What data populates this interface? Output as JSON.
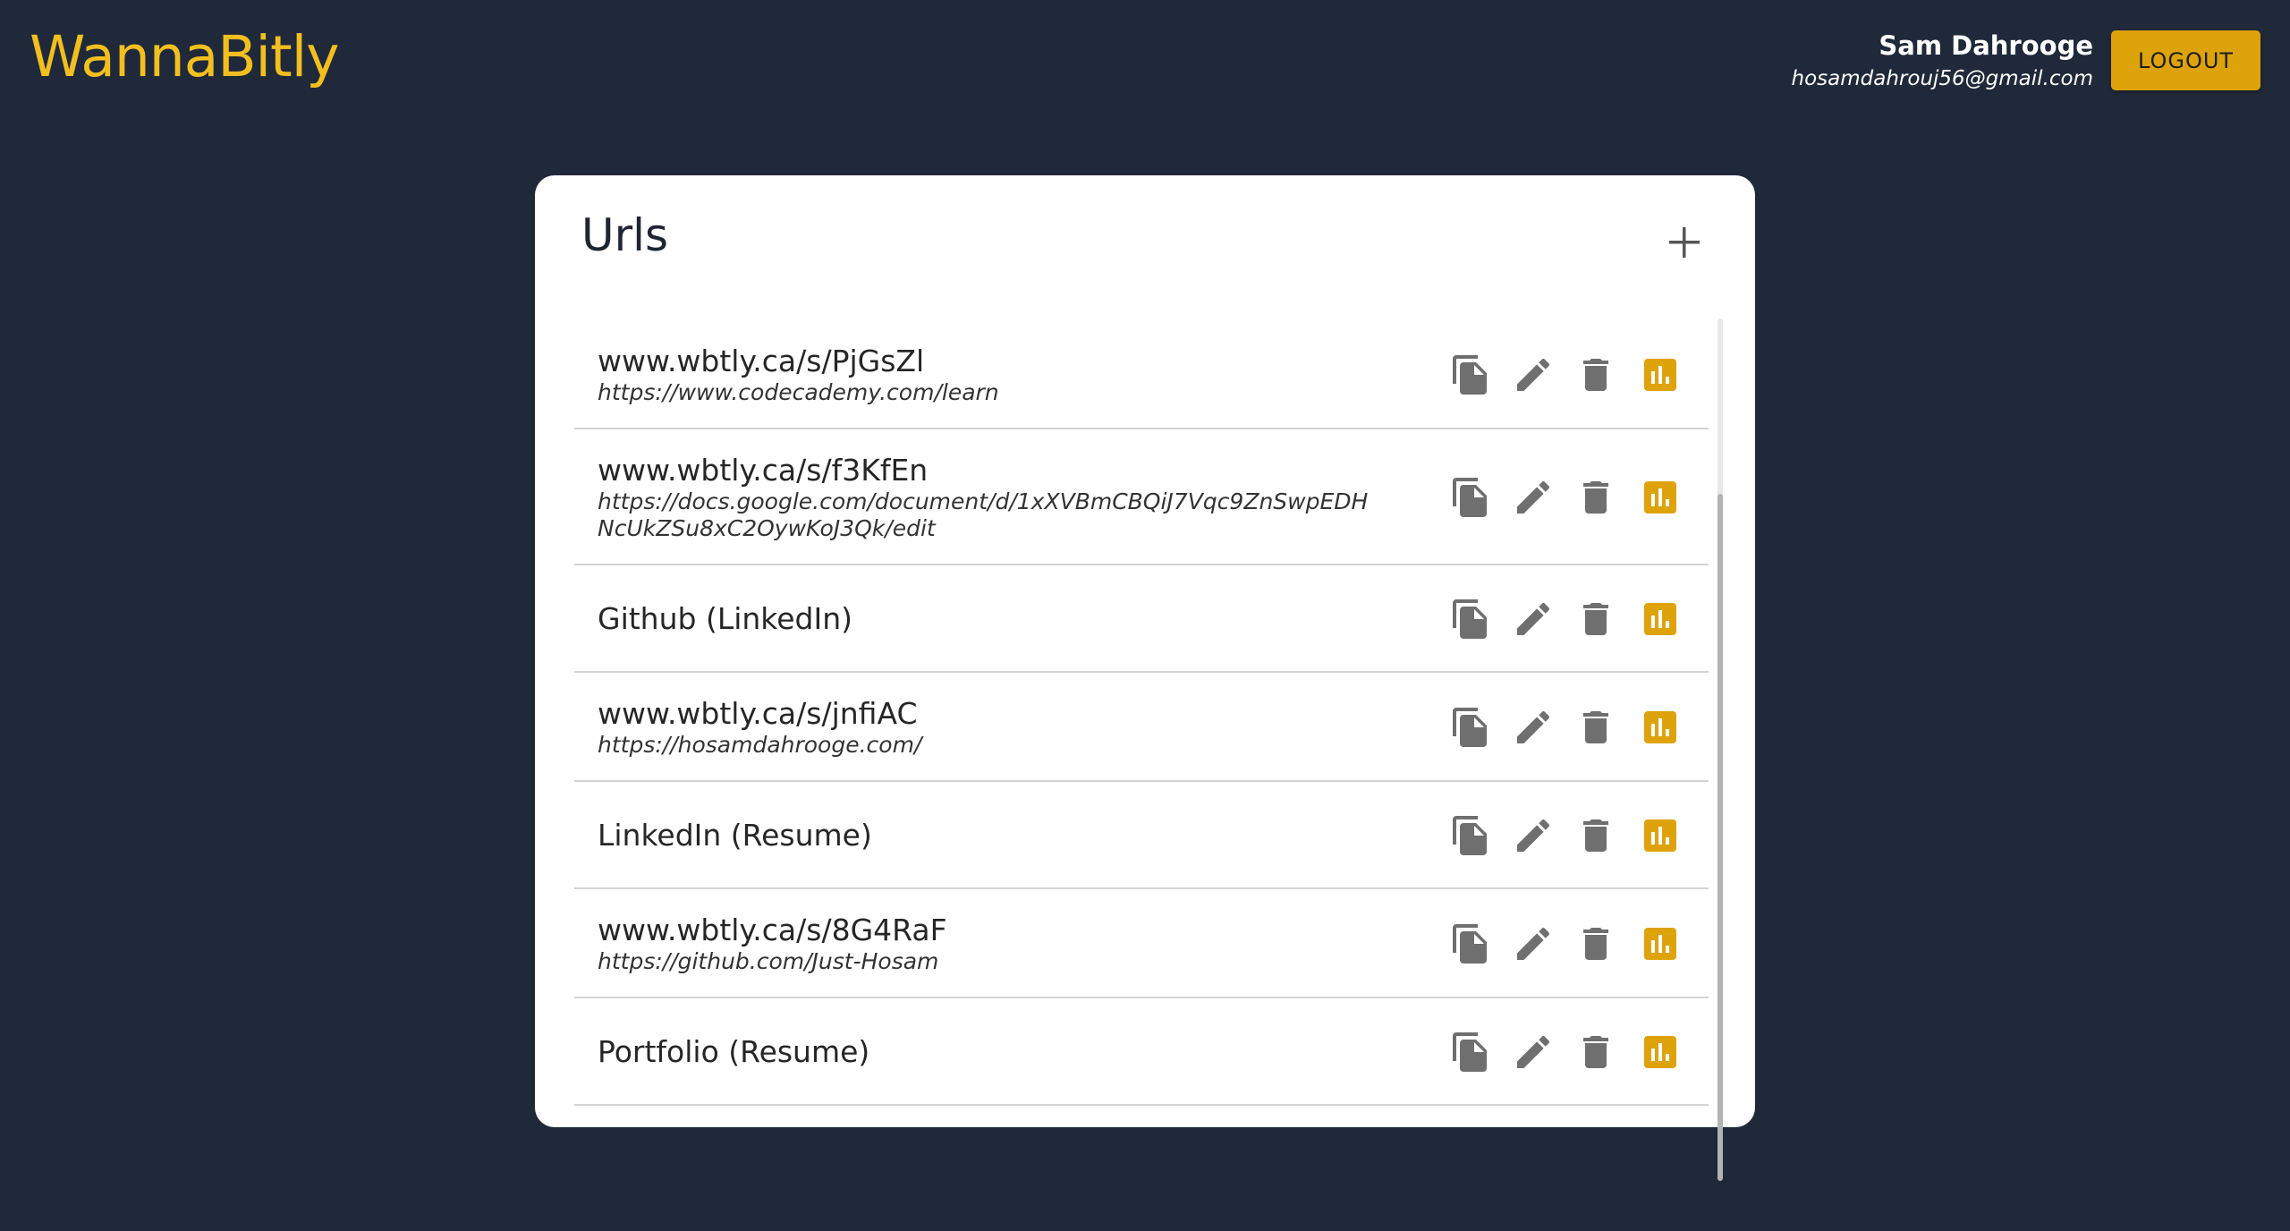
{
  "header": {
    "brand": "WannaBitly",
    "user_name": "Sam Dahrooge",
    "user_email": "hosamdahrouj56@gmail.com",
    "logout_label": "LOGOUT"
  },
  "card": {
    "title": "Urls",
    "add_icon": "plus-icon",
    "rows": [
      {
        "short": "www.wbtly.ca/s/PjGsZl",
        "long": "https://www.codecademy.com/learn"
      },
      {
        "short": "www.wbtly.ca/s/f3KfEn",
        "long": "https://docs.google.com/document/d/1xXVBmCBQiJ7Vqc9ZnSwpEDHNcUkZSu8xC2OywKoJ3Qk/edit"
      },
      {
        "short": "Github (LinkedIn)",
        "long": ""
      },
      {
        "short": "www.wbtly.ca/s/jnfiAC",
        "long": "https://hosamdahrooge.com/"
      },
      {
        "short": "LinkedIn (Resume)",
        "long": ""
      },
      {
        "short": "www.wbtly.ca/s/8G4RaF",
        "long": "https://github.com/Just-Hosam"
      },
      {
        "short": "Portfolio (Resume)",
        "long": ""
      }
    ],
    "row_actions": [
      "copy-icon",
      "edit-icon",
      "delete-icon",
      "stats-icon"
    ]
  },
  "colors": {
    "background": "#20293a",
    "brand": "#f2bf1f",
    "accent": "#dea30b",
    "icon_gray": "#6f6f6f"
  }
}
